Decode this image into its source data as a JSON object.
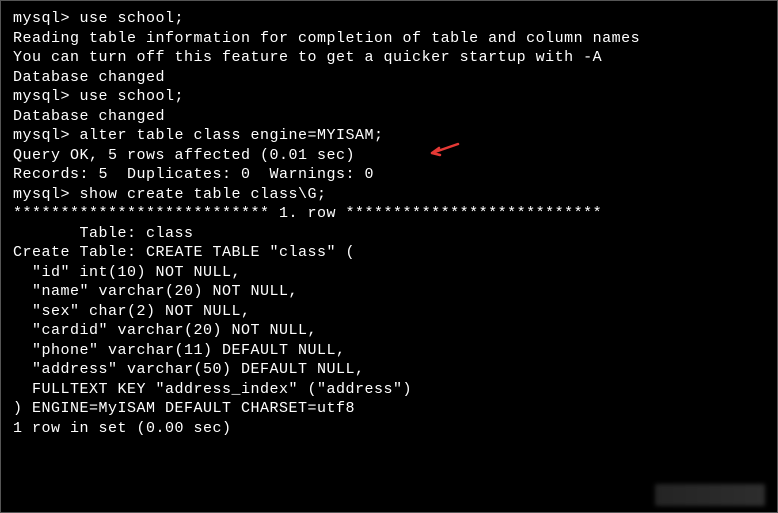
{
  "terminal": {
    "lines": [
      "mysql> use school;",
      "Reading table information for completion of table and column names",
      "You can turn off this feature to get a quicker startup with -A",
      "",
      "Database changed",
      "mysql> use school;",
      "Database changed",
      "mysql> alter table class engine=MYISAM;",
      "Query OK, 5 rows affected (0.01 sec)",
      "Records: 5  Duplicates: 0  Warnings: 0",
      "",
      "mysql> show create table class\\G;",
      "*************************** 1. row ***************************",
      "       Table: class",
      "Create Table: CREATE TABLE \"class\" (",
      "  \"id\" int(10) NOT NULL,",
      "  \"name\" varchar(20) NOT NULL,",
      "  \"sex\" char(2) NOT NULL,",
      "  \"cardid\" varchar(20) NOT NULL,",
      "  \"phone\" varchar(11) DEFAULT NULL,",
      "  \"address\" varchar(50) DEFAULT NULL,",
      "  FULLTEXT KEY \"address_index\" (\"address\")",
      ") ENGINE=MyISAM DEFAULT CHARSET=utf8",
      "1 row in set (0.00 sec)"
    ]
  },
  "annotation": {
    "arrow_color": "#e53935"
  }
}
